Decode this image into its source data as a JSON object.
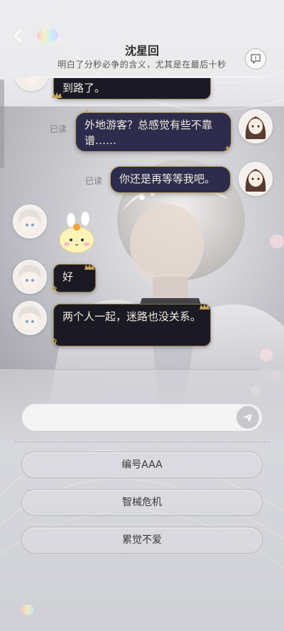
{
  "header": {
    "title": "沈星回",
    "subtitle": "明白了分秒必争的含义，尤其是在最后十秒"
  },
  "messages": [
    {
      "sender": "contact",
      "text": "到路了。"
    },
    {
      "sender": "me",
      "status": "已读",
      "text": "外地游客？总感觉有些不靠谱……"
    },
    {
      "sender": "me",
      "status": "已读",
      "text": "你还是再等等我吧。"
    },
    {
      "sender": "contact",
      "type": "sticker",
      "text": ""
    },
    {
      "sender": "contact",
      "text": "好"
    },
    {
      "sender": "contact",
      "text": "两个人一起，迷路也没关系。"
    }
  ],
  "input": {
    "placeholder": "",
    "value": ""
  },
  "options": [
    "编号AAA",
    "智械危机",
    "累觉不爱"
  ],
  "colors": {
    "contact_bubble": "#1b1a24",
    "me_bubble": "#2d2c4c",
    "bubble_border": "#b89d57",
    "background": "#dcdde2"
  },
  "icons": {
    "back": "chevron-left-icon",
    "feedback": "chat-feedback-icon",
    "send": "paper-plane-icon"
  }
}
